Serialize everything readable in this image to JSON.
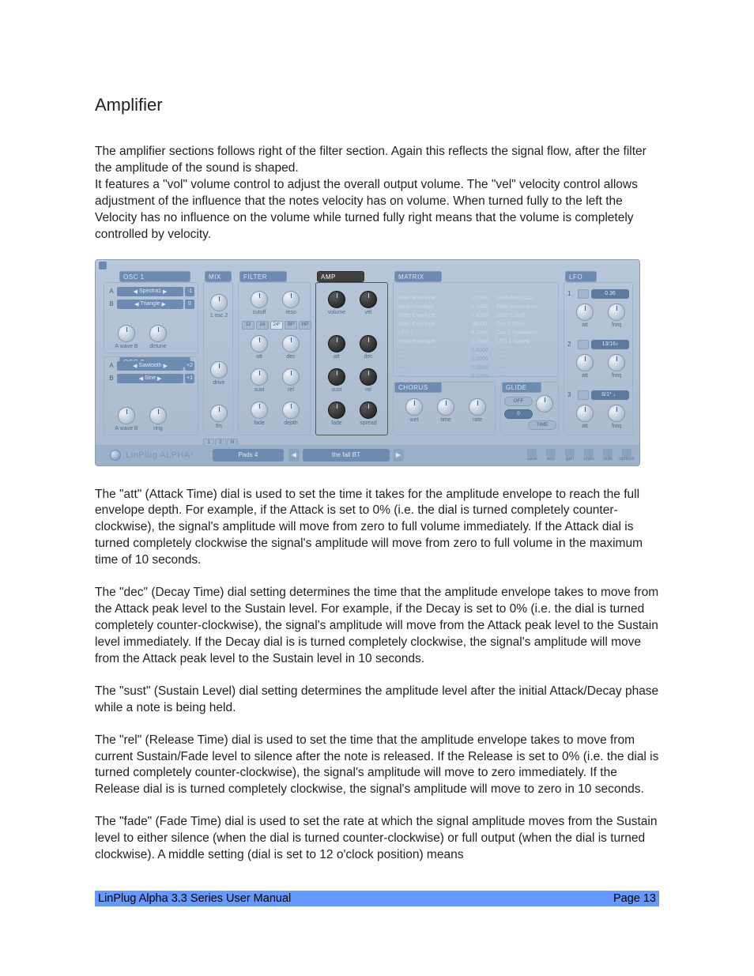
{
  "title": "Amplifier",
  "intro_a": "The amplifier sections follows right of the filter section. Again this reflects the signal flow, after the filter the amplitude of the sound is shaped.",
  "intro_b": "It features a \"vol\" volume control to adjust the overall output volume. The \"vel\" velocity control allows adjustment of the influence that the notes velocity has on volume. When turned fully to the left the Velocity has no influence on the volume while turned fully right means that the volume is completely controlled by velocity.",
  "p_att": "The \"att\" (Attack Time) dial is used to set the time it takes for the amplitude envelope to reach the full envelope depth. For example, if the Attack is set to 0% (i.e. the dial is turned completely counter-clockwise), the signal's amplitude will move from zero to full volume immediately. If the Attack dial is turned completely clockwise the signal's amplitude will move from zero to full volume in the maximum time of 10 seconds.",
  "p_dec": "The \"dec\" (Decay Time) dial setting determines the time that the amplitude envelope takes to move from the Attack peak level to the Sustain level. For example, if the Decay is set to 0% (i.e. the dial is turned completely counter-clockwise), the signal's amplitude will move from the Attack peak level to the Sustain level immediately. If the Decay dial is is turned completely clockwise, the signal's amplitude will move from the Attack peak level to the Sustain level in 10 seconds.",
  "p_sust": "The \"sust\" (Sustain Level) dial setting determines the amplitude level after the initial Attack/Decay phase while a note is being held.",
  "p_rel": "The \"rel\" (Release Time) dial is used to set the time that the amplitude envelope takes to move from current Sustain/Fade level to silence after the note is released. If the Release is set to 0% (i.e. the dial is turned completely counter-clockwise), the signal's amplitude will move to zero immediately. If the Release dial is is turned completely clockwise, the signal's amplitude will move to zero in 10 seconds.",
  "p_fade": "The \"fade\" (Fade Time) dial is used to set the rate at which the signal amplitude moves from the Sustain level to either silence (when the dial is turned counter-clockwise) or full output (when the dial is turned clockwise). A middle setting (dial is set to 12 o'clock position) means",
  "manual_title": "LinPlug Alpha 3.3 Series User Manual",
  "page_num": "Page 13",
  "synth": {
    "headers": {
      "osc1": "OSC 1",
      "osc2": "OSC 2",
      "mix": "MIX",
      "filter": "FILTER",
      "amp": "AMP",
      "matrix": "MATRIX",
      "chorus": "CHORUS",
      "glide": "GLIDE",
      "lfo": "LFO"
    },
    "osc1": {
      "a": "Spectra1",
      "a_num": "-1",
      "b": "Triangle",
      "b_num": "0",
      "bottom_a": "A wave B",
      "bottom_b": "detune"
    },
    "osc2": {
      "a": "Sawtooth",
      "a_num": "+2",
      "b": "Sine",
      "b_num": "+1",
      "bottom_a": "A wave B",
      "bottom_b": "ring"
    },
    "mix": {
      "lbl1": "1 osc 2",
      "lbl2": "drive",
      "lbl3": "fm"
    },
    "filter": {
      "labels": [
        "cutoff",
        "reso"
      ],
      "buttons": [
        "12",
        "24",
        "24*",
        "BP",
        "HP"
      ],
      "env": [
        "att",
        "dec",
        "sust",
        "rel",
        "fade",
        "depth"
      ]
    },
    "amp": {
      "top": [
        "volume",
        "vel"
      ],
      "env": [
        "att",
        "dec",
        "sust",
        "rel",
        "fade",
        "spread"
      ]
    },
    "matrix": [
      {
        "src": "Filter Envelope",
        "amt": "1.0000",
        "dst": "Main Amplitude"
      },
      {
        "src": "Amp Envelope",
        "amt": "0.4400",
        "dst": "Filter Resonance"
      },
      {
        "src": "Filter Envelope",
        "amt": "0.4200",
        "dst": "Filter Cutoff"
      },
      {
        "src": "Filter Envelope",
        "amt": "48.00",
        "dst": "Osc 2 Pitch"
      },
      {
        "src": "LFO 1",
        "amt": "0.3066",
        "dst": "Osc 1 Symmetry"
      },
      {
        "src": "Filter Envelope",
        "amt": "1.0000",
        "dst": "LFO 1 Speed"
      },
      {
        "src": "- - -",
        "amt": "0.0000",
        "dst": "- - -"
      },
      {
        "src": "- - -",
        "amt": "0.0000",
        "dst": "- - -"
      },
      {
        "src": "- - -",
        "amt": "0.0000",
        "dst": "- - -"
      },
      {
        "src": "- - -",
        "amt": "0.0000",
        "dst": "- - -"
      }
    ],
    "chorus": [
      "wet",
      "time",
      "rate"
    ],
    "glide": {
      "off": "OFF",
      "val": "0",
      "time": "TIME"
    },
    "lfo": [
      {
        "n": "1",
        "rate": "0.36",
        "a": "att",
        "b": "freq"
      },
      {
        "n": "2",
        "rate": "13/16♪",
        "a": "att",
        "b": "freq"
      },
      {
        "n": "3",
        "rate": "8/1* ♩",
        "a": "att",
        "b": "freq"
      }
    ],
    "voices": [
      "1",
      "2",
      "N"
    ],
    "footer": {
      "logo": "LinPlug ALPHA³",
      "preset_group": "Pads 4",
      "preset_name": "the fall BT",
      "icons": [
        "save",
        "eco",
        "gen",
        "undo",
        "redo",
        "options"
      ]
    }
  }
}
